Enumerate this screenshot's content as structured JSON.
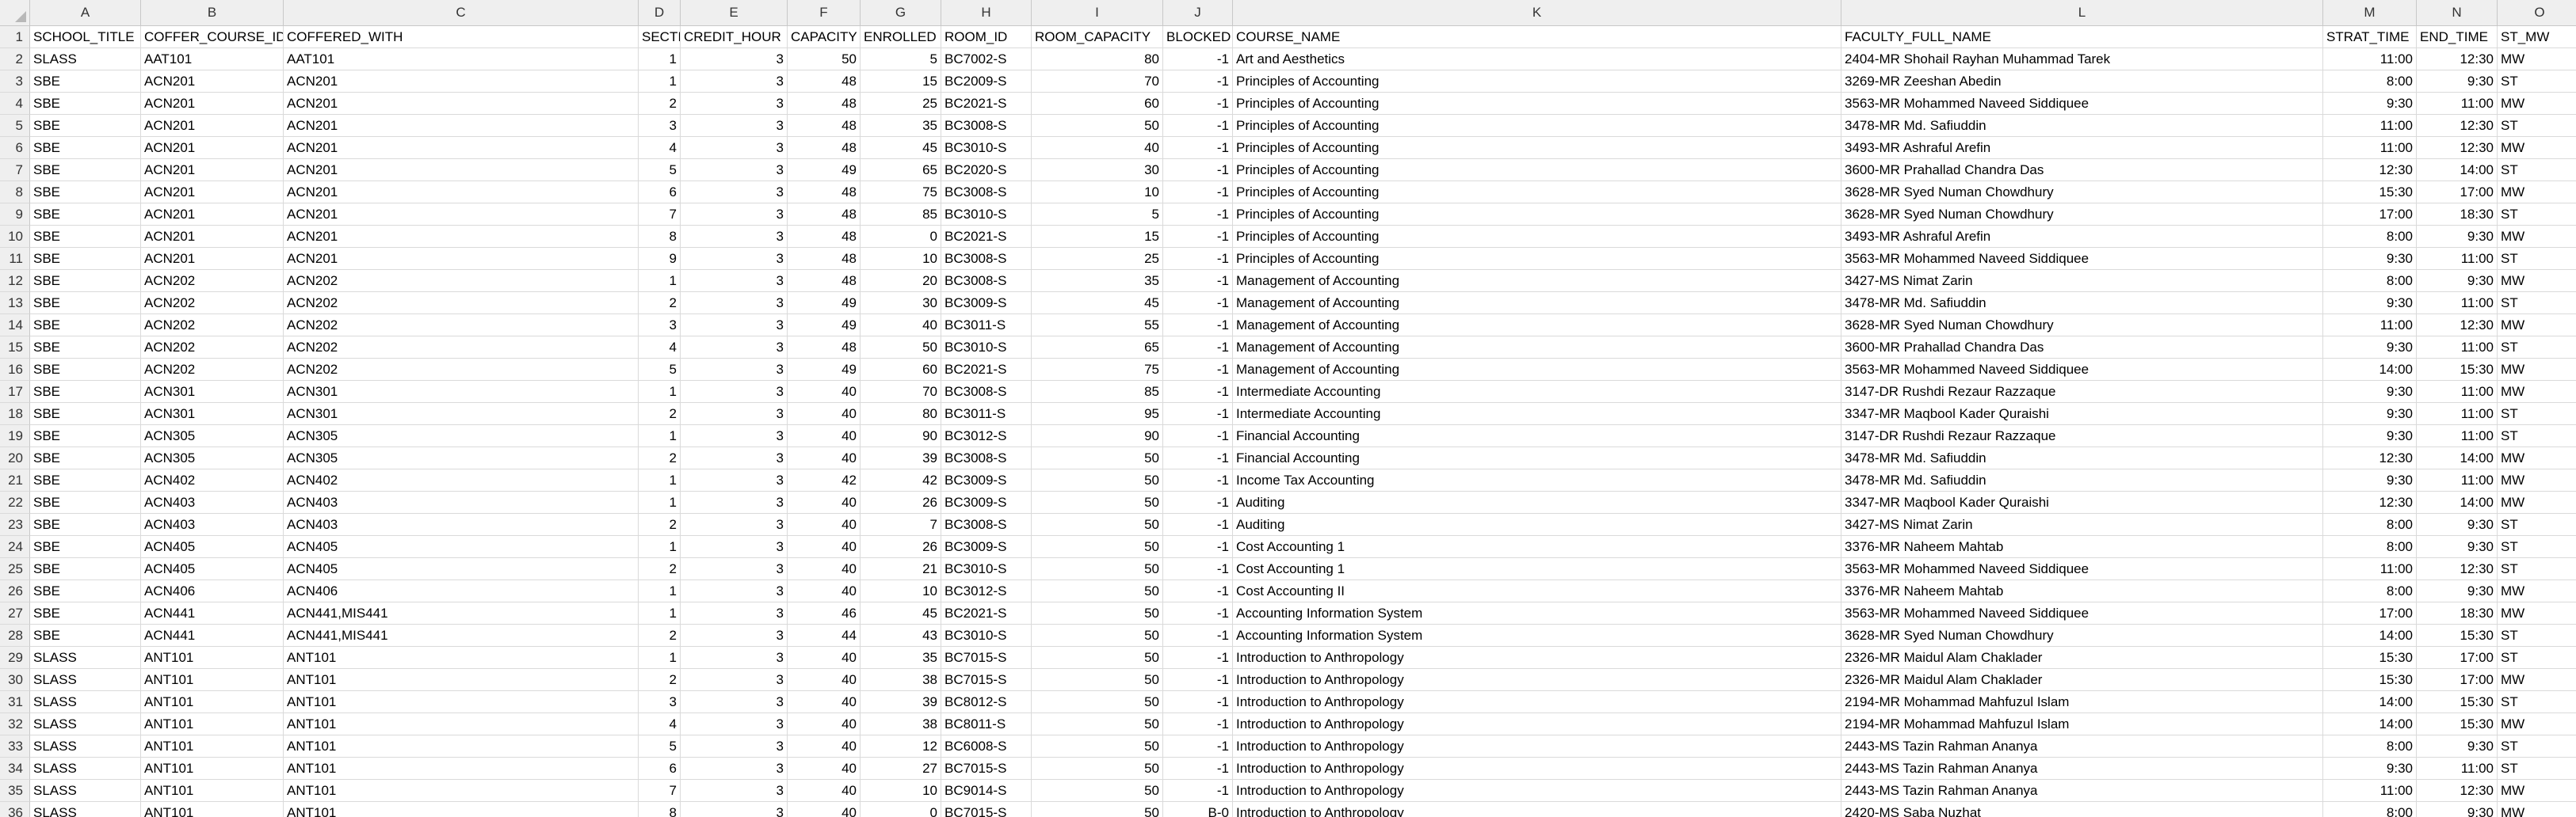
{
  "columns": [
    "A",
    "B",
    "C",
    "D",
    "E",
    "F",
    "G",
    "H",
    "I",
    "J",
    "K",
    "L",
    "M",
    "N",
    "O"
  ],
  "numeric_cols": [
    3,
    4,
    5,
    6,
    8,
    9,
    12,
    13
  ],
  "rows": [
    [
      "SCHOOL_TITLE",
      "COFFER_COURSE_ID",
      "COFFERED_WITH",
      "SECTION",
      "CREDIT_HOUR",
      "CAPACITY",
      "ENROLLED",
      "ROOM_ID",
      "ROOM_CAPACITY",
      "BLOCKED",
      "COURSE_NAME",
      "FACULTY_FULL_NAME",
      "STRAT_TIME",
      "END_TIME",
      "ST_MW"
    ],
    [
      "SLASS",
      "AAT101",
      "AAT101",
      "1",
      "3",
      "50",
      "5",
      "BC7002-S",
      "80",
      "-1",
      "Art and Aesthetics",
      "2404-MR Shohail Rayhan Muhammad Tarek",
      "11:00",
      "12:30",
      "MW"
    ],
    [
      "SBE",
      "ACN201",
      "ACN201",
      "1",
      "3",
      "48",
      "15",
      "BC2009-S",
      "70",
      "-1",
      "Principles of Accounting",
      "3269-MR Zeeshan Abedin",
      "8:00",
      "9:30",
      "ST"
    ],
    [
      "SBE",
      "ACN201",
      "ACN201",
      "2",
      "3",
      "48",
      "25",
      "BC2021-S",
      "60",
      "-1",
      "Principles of Accounting",
      "3563-MR Mohammed Naveed Siddiquee",
      "9:30",
      "11:00",
      "MW"
    ],
    [
      "SBE",
      "ACN201",
      "ACN201",
      "3",
      "3",
      "48",
      "35",
      "BC3008-S",
      "50",
      "-1",
      "Principles of Accounting",
      "3478-MR Md. Safiuddin",
      "11:00",
      "12:30",
      "ST"
    ],
    [
      "SBE",
      "ACN201",
      "ACN201",
      "4",
      "3",
      "48",
      "45",
      "BC3010-S",
      "40",
      "-1",
      "Principles of Accounting",
      "3493-MR Ashraful Arefin",
      "11:00",
      "12:30",
      "MW"
    ],
    [
      "SBE",
      "ACN201",
      "ACN201",
      "5",
      "3",
      "49",
      "65",
      "BC2020-S",
      "30",
      "-1",
      "Principles of Accounting",
      "3600-MR Prahallad Chandra Das",
      "12:30",
      "14:00",
      "ST"
    ],
    [
      "SBE",
      "ACN201",
      "ACN201",
      "6",
      "3",
      "48",
      "75",
      "BC3008-S",
      "10",
      "-1",
      "Principles of Accounting",
      "3628-MR Syed Numan Chowdhury",
      "15:30",
      "17:00",
      "MW"
    ],
    [
      "SBE",
      "ACN201",
      "ACN201",
      "7",
      "3",
      "48",
      "85",
      "BC3010-S",
      "5",
      "-1",
      "Principles of Accounting",
      "3628-MR Syed Numan Chowdhury",
      "17:00",
      "18:30",
      "ST"
    ],
    [
      "SBE",
      "ACN201",
      "ACN201",
      "8",
      "3",
      "48",
      "0",
      "BC2021-S",
      "15",
      "-1",
      "Principles of Accounting",
      "3493-MR Ashraful Arefin",
      "8:00",
      "9:30",
      "MW"
    ],
    [
      "SBE",
      "ACN201",
      "ACN201",
      "9",
      "3",
      "48",
      "10",
      "BC3008-S",
      "25",
      "-1",
      "Principles of Accounting",
      "3563-MR Mohammed Naveed Siddiquee",
      "9:30",
      "11:00",
      "ST"
    ],
    [
      "SBE",
      "ACN202",
      "ACN202",
      "1",
      "3",
      "48",
      "20",
      "BC3008-S",
      "35",
      "-1",
      "Management of Accounting",
      "3427-MS Nimat Zarin",
      "8:00",
      "9:30",
      "MW"
    ],
    [
      "SBE",
      "ACN202",
      "ACN202",
      "2",
      "3",
      "49",
      "30",
      "BC3009-S",
      "45",
      "-1",
      "Management of Accounting",
      "3478-MR Md. Safiuddin",
      "9:30",
      "11:00",
      "ST"
    ],
    [
      "SBE",
      "ACN202",
      "ACN202",
      "3",
      "3",
      "49",
      "40",
      "BC3011-S",
      "55",
      "-1",
      "Management of Accounting",
      "3628-MR Syed Numan Chowdhury",
      "11:00",
      "12:30",
      "MW"
    ],
    [
      "SBE",
      "ACN202",
      "ACN202",
      "4",
      "3",
      "48",
      "50",
      "BC3010-S",
      "65",
      "-1",
      "Management of Accounting",
      "3600-MR Prahallad Chandra Das",
      "9:30",
      "11:00",
      "ST"
    ],
    [
      "SBE",
      "ACN202",
      "ACN202",
      "5",
      "3",
      "49",
      "60",
      "BC2021-S",
      "75",
      "-1",
      "Management of Accounting",
      "3563-MR Mohammed Naveed Siddiquee",
      "14:00",
      "15:30",
      "MW"
    ],
    [
      "SBE",
      "ACN301",
      "ACN301",
      "1",
      "3",
      "40",
      "70",
      "BC3008-S",
      "85",
      "-1",
      "Intermediate Accounting",
      "3147-DR Rushdi Rezaur Razzaque",
      "9:30",
      "11:00",
      "MW"
    ],
    [
      "SBE",
      "ACN301",
      "ACN301",
      "2",
      "3",
      "40",
      "80",
      "BC3011-S",
      "95",
      "-1",
      "Intermediate Accounting",
      "3347-MR Maqbool Kader Quraishi",
      "9:30",
      "11:00",
      "ST"
    ],
    [
      "SBE",
      "ACN305",
      "ACN305",
      "1",
      "3",
      "40",
      "90",
      "BC3012-S",
      "90",
      "-1",
      "Financial Accounting",
      "3147-DR Rushdi Rezaur Razzaque",
      "9:30",
      "11:00",
      "ST"
    ],
    [
      "SBE",
      "ACN305",
      "ACN305",
      "2",
      "3",
      "40",
      "39",
      "BC3008-S",
      "50",
      "-1",
      "Financial Accounting",
      "3478-MR Md. Safiuddin",
      "12:30",
      "14:00",
      "MW"
    ],
    [
      "SBE",
      "ACN402",
      "ACN402",
      "1",
      "3",
      "42",
      "42",
      "BC3009-S",
      "50",
      "-1",
      "Income Tax Accounting",
      "3478-MR Md. Safiuddin",
      "9:30",
      "11:00",
      "MW"
    ],
    [
      "SBE",
      "ACN403",
      "ACN403",
      "1",
      "3",
      "40",
      "26",
      "BC3009-S",
      "50",
      "-1",
      "Auditing",
      "3347-MR Maqbool Kader Quraishi",
      "12:30",
      "14:00",
      "MW"
    ],
    [
      "SBE",
      "ACN403",
      "ACN403",
      "2",
      "3",
      "40",
      "7",
      "BC3008-S",
      "50",
      "-1",
      "Auditing",
      "3427-MS Nimat Zarin",
      "8:00",
      "9:30",
      "ST"
    ],
    [
      "SBE",
      "ACN405",
      "ACN405",
      "1",
      "3",
      "40",
      "26",
      "BC3009-S",
      "50",
      "-1",
      "Cost Accounting 1",
      "3376-MR Naheem Mahtab",
      "8:00",
      "9:30",
      "ST"
    ],
    [
      "SBE",
      "ACN405",
      "ACN405",
      "2",
      "3",
      "40",
      "21",
      "BC3010-S",
      "50",
      "-1",
      "Cost Accounting 1",
      "3563-MR Mohammed Naveed Siddiquee",
      "11:00",
      "12:30",
      "ST"
    ],
    [
      "SBE",
      "ACN406",
      "ACN406",
      "1",
      "3",
      "40",
      "10",
      "BC3012-S",
      "50",
      "-1",
      "Cost Accounting II",
      "3376-MR Naheem Mahtab",
      "8:00",
      "9:30",
      "MW"
    ],
    [
      "SBE",
      "ACN441",
      "ACN441,MIS441",
      "1",
      "3",
      "46",
      "45",
      "BC2021-S",
      "50",
      "-1",
      "Accounting Information System",
      "3563-MR Mohammed Naveed Siddiquee",
      "17:00",
      "18:30",
      "MW"
    ],
    [
      "SBE",
      "ACN441",
      "ACN441,MIS441",
      "2",
      "3",
      "44",
      "43",
      "BC3010-S",
      "50",
      "-1",
      "Accounting Information System",
      "3628-MR Syed Numan Chowdhury",
      "14:00",
      "15:30",
      "ST"
    ],
    [
      "SLASS",
      "ANT101",
      "ANT101",
      "1",
      "3",
      "40",
      "35",
      "BC7015-S",
      "50",
      "-1",
      "Introduction to Anthropology",
      "2326-MR Maidul Alam Chaklader",
      "15:30",
      "17:00",
      "ST"
    ],
    [
      "SLASS",
      "ANT101",
      "ANT101",
      "2",
      "3",
      "40",
      "38",
      "BC7015-S",
      "50",
      "-1",
      "Introduction to Anthropology",
      "2326-MR Maidul Alam Chaklader",
      "15:30",
      "17:00",
      "MW"
    ],
    [
      "SLASS",
      "ANT101",
      "ANT101",
      "3",
      "3",
      "40",
      "39",
      "BC8012-S",
      "50",
      "-1",
      "Introduction to Anthropology",
      "2194-MR Mohammad Mahfuzul Islam",
      "14:00",
      "15:30",
      "ST"
    ],
    [
      "SLASS",
      "ANT101",
      "ANT101",
      "4",
      "3",
      "40",
      "38",
      "BC8011-S",
      "50",
      "-1",
      "Introduction to Anthropology",
      "2194-MR Mohammad Mahfuzul Islam",
      "14:00",
      "15:30",
      "MW"
    ],
    [
      "SLASS",
      "ANT101",
      "ANT101",
      "5",
      "3",
      "40",
      "12",
      "BC6008-S",
      "50",
      "-1",
      "Introduction to Anthropology",
      "2443-MS Tazin Rahman Ananya",
      "8:00",
      "9:30",
      "ST"
    ],
    [
      "SLASS",
      "ANT101",
      "ANT101",
      "6",
      "3",
      "40",
      "27",
      "BC7015-S",
      "50",
      "-1",
      "Introduction to Anthropology",
      "2443-MS Tazin Rahman Ananya",
      "9:30",
      "11:00",
      "ST"
    ],
    [
      "SLASS",
      "ANT101",
      "ANT101",
      "7",
      "3",
      "40",
      "10",
      "BC9014-S",
      "50",
      "-1",
      "Introduction to Anthropology",
      "2443-MS Tazin Rahman Ananya",
      "11:00",
      "12:30",
      "MW"
    ],
    [
      "SLASS",
      "ANT101",
      "ANT101",
      "8",
      "3",
      "40",
      "0",
      "BC7015-S",
      "50",
      "B-0",
      "Introduction to Anthropology",
      "2420-MS Saba Nuzhat",
      "8:00",
      "9:30",
      "MW"
    ]
  ]
}
